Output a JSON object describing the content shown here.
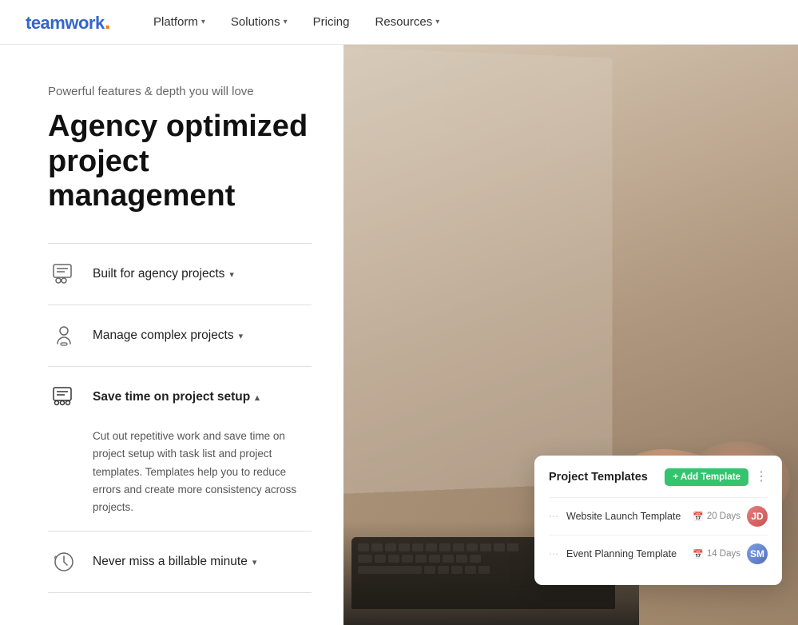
{
  "logo": {
    "text": "teamwork",
    "dot": "."
  },
  "nav": {
    "items": [
      {
        "label": "Platform",
        "hasDropdown": true
      },
      {
        "label": "Solutions",
        "hasDropdown": true
      },
      {
        "label": "Pricing",
        "hasDropdown": false
      },
      {
        "label": "Resources",
        "hasDropdown": true
      }
    ]
  },
  "hero": {
    "tagline": "Powerful features & depth you will love",
    "headline_line1": "Agency optimized project",
    "headline_line2": "management"
  },
  "accordion": {
    "items": [
      {
        "id": "agency",
        "title": "Built for agency projects",
        "hasDropdown": true,
        "expanded": false,
        "body": ""
      },
      {
        "id": "complex",
        "title": "Manage complex projects",
        "hasDropdown": true,
        "expanded": false,
        "body": ""
      },
      {
        "id": "setup",
        "title": "Save time on project setup",
        "hasDropdown": false,
        "expanded": true,
        "body": "Cut out repetitive work and save time on project setup with task list and project templates. Templates help you to reduce errors and create more consistency across projects."
      },
      {
        "id": "billable",
        "title": "Never miss a billable minute",
        "hasDropdown": true,
        "expanded": false,
        "body": ""
      }
    ]
  },
  "card": {
    "title": "Project Templates",
    "add_button": "Add Template",
    "templates": [
      {
        "name": "Website Launch Template",
        "days": "20 Days"
      },
      {
        "name": "Event Planning Template",
        "days": "14 Days"
      }
    ]
  },
  "colors": {
    "green": "#36c36e",
    "accent": "#f47920"
  }
}
